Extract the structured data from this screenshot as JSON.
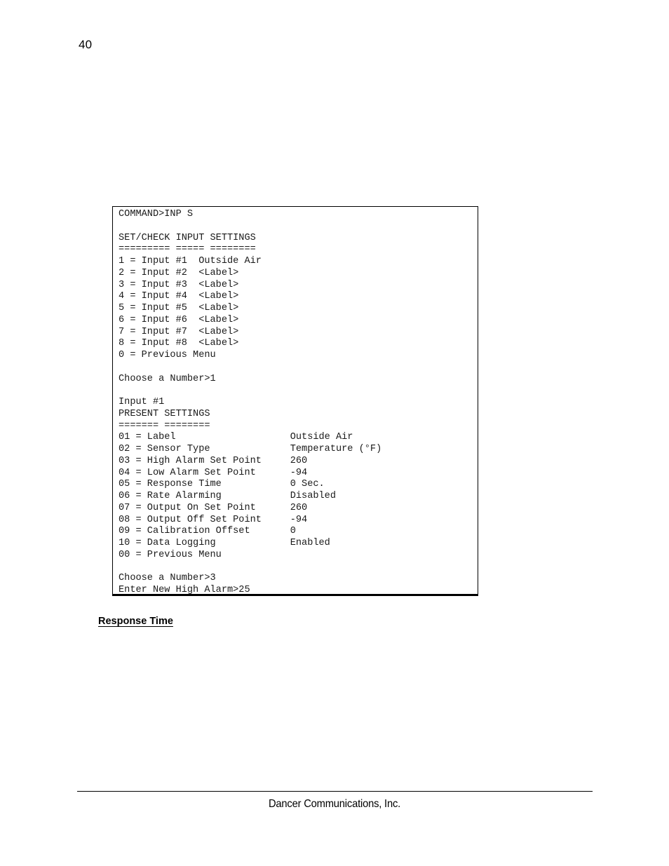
{
  "page": {
    "number": "40"
  },
  "console": {
    "name": "terminal-transcript",
    "lines": [
      "COMMAND>INP S",
      "",
      "SET/CHECK INPUT SETTINGS",
      "========= ===== ========",
      "1 = Input #1  Outside Air",
      "2 = Input #2  <Label>",
      "3 = Input #3  <Label>",
      "4 = Input #4  <Label>",
      "5 = Input #5  <Label>",
      "6 = Input #6  <Label>",
      "7 = Input #7  <Label>",
      "8 = Input #8  <Label>",
      "0 = Previous Menu",
      "",
      "Choose a Number>1",
      "",
      "Input #1",
      "PRESENT SETTINGS",
      "======= ========",
      "01 = Label                    Outside Air",
      "02 = Sensor Type              Temperature (°F)",
      "03 = High Alarm Set Point     260",
      "04 = Low Alarm Set Point      -94",
      "05 = Response Time            0 Sec.",
      "06 = Rate Alarming            Disabled",
      "07 = Output On Set Point      260",
      "08 = Output Off Set Point     -94",
      "09 = Calibration Offset       0",
      "10 = Data Logging             Enabled",
      "00 = Previous Menu",
      "",
      "Choose a Number>3",
      "Enter New High Alarm>25"
    ],
    "command_prompt": "COMMAND>INP S",
    "menu_title": "SET/CHECK INPUT SETTINGS",
    "menu_items": [
      {
        "key": "1",
        "label": "Input #1",
        "value": "Outside Air"
      },
      {
        "key": "2",
        "label": "Input #2",
        "value": "<Label>"
      },
      {
        "key": "3",
        "label": "Input #3",
        "value": "<Label>"
      },
      {
        "key": "4",
        "label": "Input #4",
        "value": "<Label>"
      },
      {
        "key": "5",
        "label": "Input #5",
        "value": "<Label>"
      },
      {
        "key": "6",
        "label": "Input #6",
        "value": "<Label>"
      },
      {
        "key": "7",
        "label": "Input #7",
        "value": "<Label>"
      },
      {
        "key": "8",
        "label": "Input #8",
        "value": "<Label>"
      },
      {
        "key": "0",
        "label": "Previous Menu",
        "value": ""
      }
    ],
    "menu_prompt": "Choose a Number>1",
    "detail_header": "Input #1",
    "detail_title": "PRESENT SETTINGS",
    "settings": [
      {
        "key": "01",
        "label": "Label",
        "value": "Outside Air"
      },
      {
        "key": "02",
        "label": "Sensor Type",
        "value": "Temperature (°F)"
      },
      {
        "key": "03",
        "label": "High Alarm Set Point",
        "value": "260"
      },
      {
        "key": "04",
        "label": "Low Alarm Set Point",
        "value": "-94"
      },
      {
        "key": "05",
        "label": "Response Time",
        "value": "0 Sec."
      },
      {
        "key": "06",
        "label": "Rate Alarming",
        "value": "Disabled"
      },
      {
        "key": "07",
        "label": "Output On Set Point",
        "value": "260"
      },
      {
        "key": "08",
        "label": "Output Off Set Point",
        "value": "-94"
      },
      {
        "key": "09",
        "label": "Calibration Offset",
        "value": "0"
      },
      {
        "key": "10",
        "label": "Data Logging",
        "value": "Enabled"
      },
      {
        "key": "00",
        "label": "Previous Menu",
        "value": ""
      }
    ],
    "settings_prompt": "Choose a Number>3",
    "entry_prompt": "Enter New High Alarm>25"
  },
  "body": {
    "section_heading": "Response Time"
  },
  "footer": {
    "text": "Dancer Communications, Inc."
  },
  "colors": {
    "page_background": "#ffffff",
    "text": "#000000",
    "console_text": "#1a1a1a",
    "border": "#000000"
  }
}
